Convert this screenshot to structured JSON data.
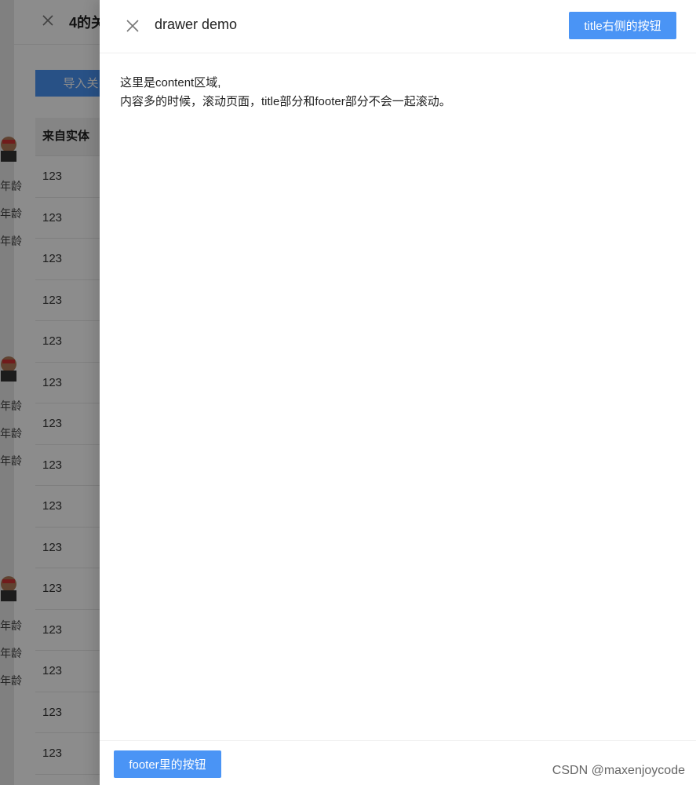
{
  "background": {
    "drawer_title": "4的关",
    "import_button": "导入关系",
    "table": {
      "header": "来自实体",
      "rows": [
        "123",
        "123",
        "123",
        "123",
        "123",
        "123",
        "123",
        "123",
        "123",
        "123",
        "123",
        "123",
        "123",
        "123",
        "123"
      ]
    },
    "age_labels": [
      "年龄",
      "年龄",
      "年龄",
      "年龄",
      "年龄",
      "年龄",
      "年龄",
      "年龄",
      "年龄"
    ]
  },
  "drawer": {
    "title": "drawer demo",
    "title_button": "title右侧的按钮",
    "content_lines": [
      "这里是content区域,",
      "内容多的时候，滚动页面，title部分和footer部分不会一起滚动。"
    ],
    "footer_button": "footer里的按钮"
  },
  "watermark": "CSDN @maxenjoycode",
  "colors": {
    "primary": "#4a94f5",
    "mask": "rgba(0,0,0,0.45)"
  },
  "icons": {
    "close": "close-icon",
    "avatar": "avatar-icon"
  }
}
